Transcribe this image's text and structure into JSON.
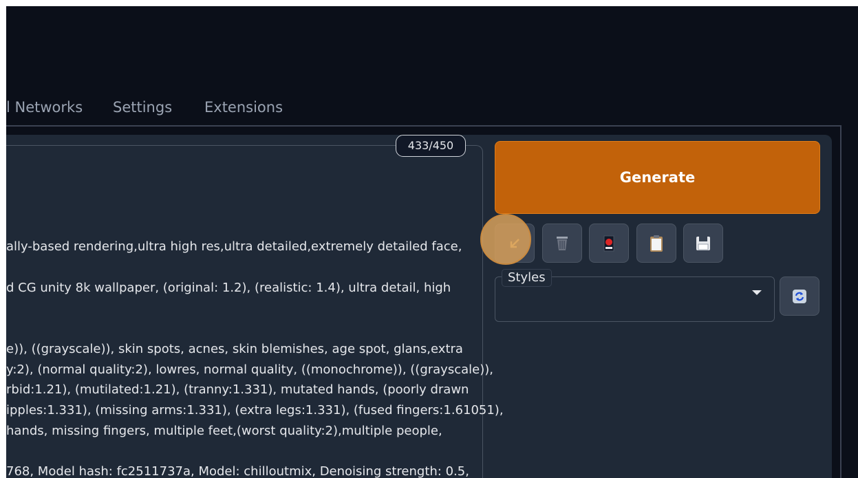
{
  "tabs": [
    {
      "label": "l Networks"
    },
    {
      "label": "Settings"
    },
    {
      "label": "Extensions"
    }
  ],
  "prompt": {
    "token_counter": "433/450",
    "lines": [
      {
        "text": "ally-based rendering,ultra high res,ultra detailed,extremely detailed face,"
      },
      {
        "text": "d CG unity 8k wallpaper, (original: 1.2), (realistic: 1.4), ultra detail, high"
      },
      {
        "text": "e)), ((grayscale)), skin spots, acnes, skin blemishes, age spot, glans,extra"
      },
      {
        "text": "y:2), (normal quality:2), lowres, normal quality, ((monochrome)), ((grayscale)),"
      },
      {
        "text": "rbid:1.21), (mutilated:1.21), (tranny:1.331), mutated hands, (poorly drawn"
      },
      {
        "text": "ipples:1.331), (missing arms:1.331), (extra legs:1.331), (fused fingers:1.61051),"
      },
      {
        "text": "hands, missing fingers, multiple feet,(worst quality:2),multiple people,"
      },
      {
        "text": "768, Model hash: fc2511737a, Model: chilloutmix, Denoising strength: 0.5,"
      }
    ]
  },
  "actions": {
    "generate_label": "Generate",
    "tool_icons": [
      "paste-arrow-icon",
      "trash-icon",
      "red-card-icon",
      "clipboard-icon",
      "save-disk-icon"
    ]
  },
  "styles": {
    "label": "Styles",
    "selected": ""
  },
  "colors": {
    "background": "#0b0f19",
    "panel": "#1f2937",
    "generate": "#c2620a",
    "highlight": "#d7a05a",
    "spell_underline": "#e11d48"
  }
}
